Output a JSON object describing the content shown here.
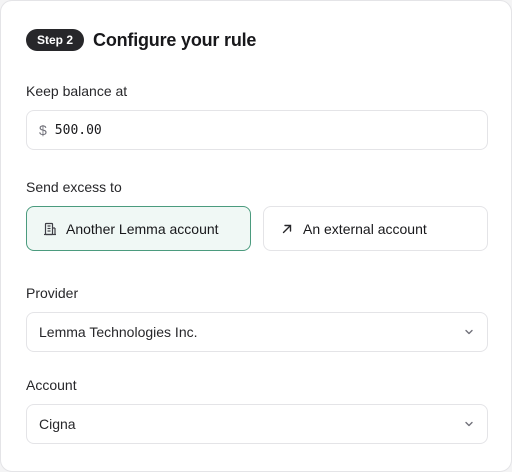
{
  "header": {
    "step_badge": "Step 2",
    "title": "Configure your rule"
  },
  "balance": {
    "label": "Keep balance at",
    "currency_symbol": "$",
    "value": "500.00"
  },
  "excess": {
    "label": "Send excess to",
    "options": [
      {
        "label": "Another Lemma account",
        "icon": "building-icon",
        "selected": true
      },
      {
        "label": "An external account",
        "icon": "arrow-up-right-icon",
        "selected": false
      }
    ]
  },
  "provider": {
    "label": "Provider",
    "value": "Lemma Technologies Inc."
  },
  "account": {
    "label": "Account",
    "value": "Cigna"
  },
  "colors": {
    "badge_bg": "#27272a",
    "selected_border": "#4b9b7e",
    "selected_bg": "#f0f8f5",
    "border": "#e4e4e7"
  }
}
